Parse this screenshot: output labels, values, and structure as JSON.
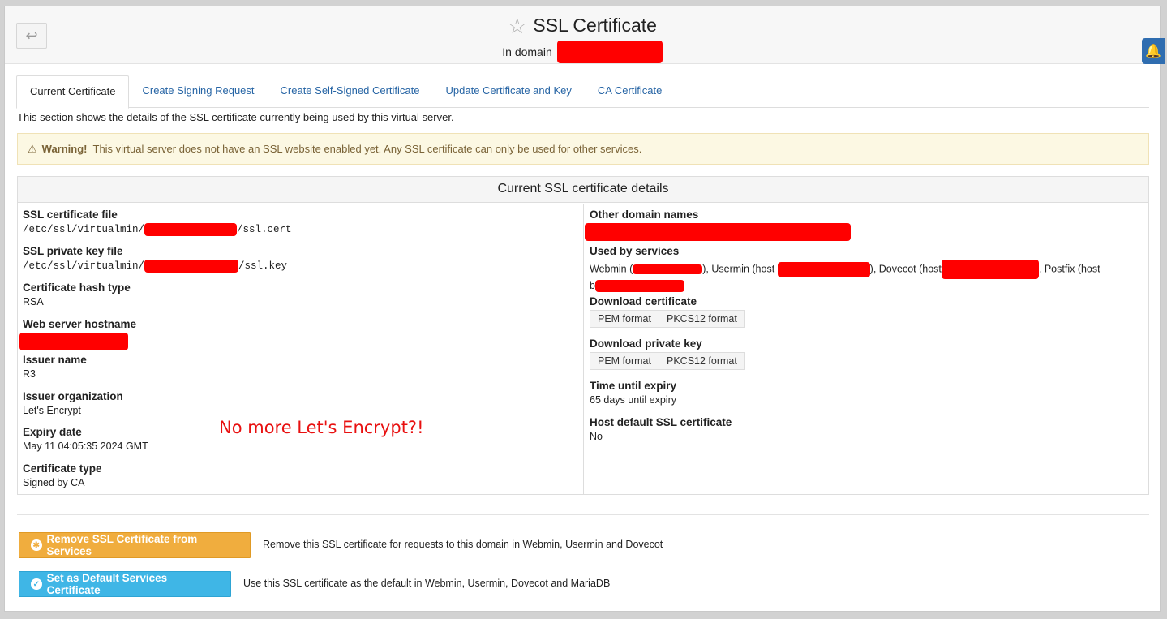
{
  "header": {
    "back_icon": "return-arrow-icon",
    "title": "SSL Certificate",
    "subtitle_prefix": "In domain"
  },
  "tabs": [
    {
      "label": "Current Certificate",
      "active": true
    },
    {
      "label": "Create Signing Request",
      "active": false
    },
    {
      "label": "Create Self-Signed Certificate",
      "active": false
    },
    {
      "label": "Update Certificate and Key",
      "active": false
    },
    {
      "label": "CA Certificate",
      "active": false
    }
  ],
  "intro": "This section shows the details of the SSL certificate currently being used by this virtual server.",
  "warning": {
    "strong": "Warning!",
    "text": "This virtual server does not have an SSL website enabled yet. Any SSL certificate can only be used for other services."
  },
  "panel": {
    "title": "Current SSL certificate details",
    "left": {
      "cert_file": {
        "label": "SSL certificate file",
        "prefix": "/etc/ssl/virtualmin/",
        "suffix": "/ssl.cert"
      },
      "key_file": {
        "label": "SSL private key file",
        "prefix": "/etc/ssl/virtualmin/",
        "suffix": "/ssl.key"
      },
      "hash_type": {
        "label": "Certificate hash type",
        "value": "RSA"
      },
      "hostname": {
        "label": "Web server hostname"
      },
      "issuer_name": {
        "label": "Issuer name",
        "value": "R3"
      },
      "issuer_org": {
        "label": "Issuer organization",
        "value": "Let's Encrypt"
      },
      "expiry": {
        "label": "Expiry date",
        "value": "May 11 04:05:35 2024 GMT"
      },
      "cert_type": {
        "label": "Certificate type",
        "value": "Signed by CA"
      }
    },
    "right": {
      "other_domains": {
        "label": "Other domain names"
      },
      "services": {
        "label": "Used by services",
        "webmin": "Webmin (",
        "usermin": "), Usermin (host",
        "dovecot": "), Dovecot (host",
        "postfix": ", Postfix (host",
        "tail": "b"
      },
      "download_cert": {
        "label": "Download certificate",
        "pem": "PEM format",
        "pkcs12": "PKCS12 format"
      },
      "download_key": {
        "label": "Download private key",
        "pem": "PEM format",
        "pkcs12": "PKCS12 format"
      },
      "expiry_time": {
        "label": "Time until expiry",
        "value": "65 days until expiry"
      },
      "host_default": {
        "label": "Host default SSL certificate",
        "value": "No"
      }
    }
  },
  "annotation": "No more Let's Encrypt?!",
  "actions": {
    "remove": {
      "label": "Remove SSL Certificate from Services",
      "desc": "Remove this SSL certificate for requests to this domain in Webmin, Usermin and Dovecot"
    },
    "default": {
      "label": "Set as Default Services Certificate",
      "desc": "Use this SSL certificate as the default in Webmin, Usermin, Dovecot and MariaDB"
    }
  },
  "colors": {
    "link": "#2765a5",
    "warning_bg": "#fcf8e3",
    "remove_btn": "#f0ad3e",
    "default_btn": "#3fb6e6",
    "redaction": "#ff0000",
    "annotation": "#e81010"
  }
}
